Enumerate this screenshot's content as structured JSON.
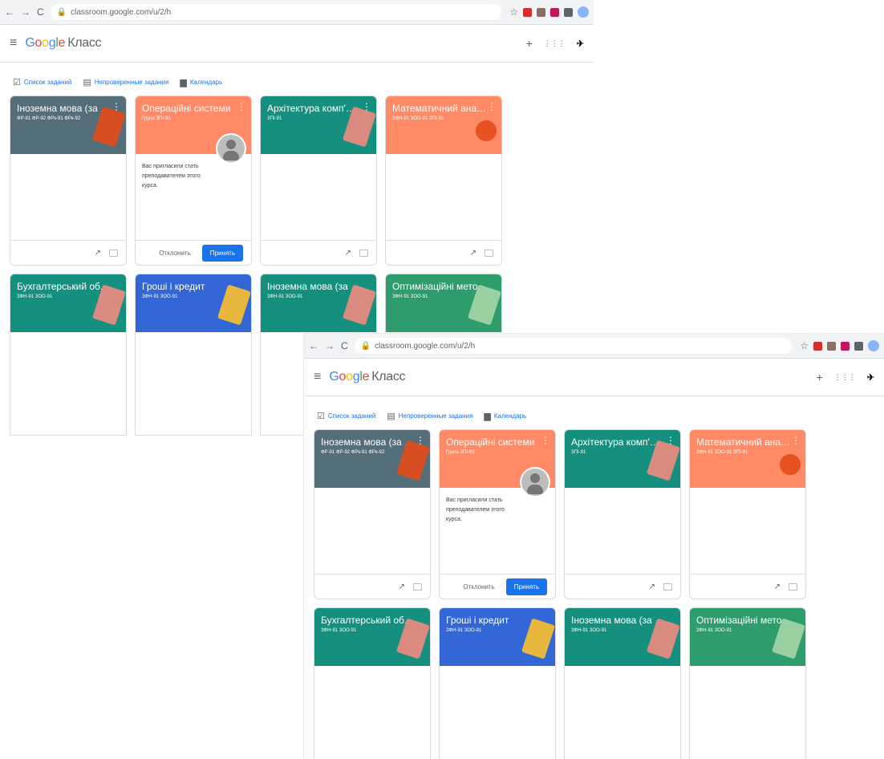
{
  "browser": {
    "url": "classroom.google.com/u/2/h"
  },
  "app": {
    "logo_g": "G",
    "logo_o1": "o",
    "logo_o2": "o",
    "logo_g2": "g",
    "logo_l": "l",
    "logo_e": "e",
    "logo_product": "Класс",
    "add_label": "+",
    "apps_label": "⋮⋮⋮"
  },
  "tools": {
    "todo": "Список заданий",
    "review": "Непроверенные задания",
    "calendar": "Календарь"
  },
  "invite": {
    "text": "Вас пригласили стать преподавателем этого курса.",
    "decline": "Отклонить",
    "accept": "Принять"
  },
  "courses": [
    {
      "title": "Іноземна мова (за п...",
      "subtitle": "ФР-91 ФР-92 ФРк-91 ФРк-92",
      "color": "#546e7a",
      "accent": "#e64a19"
    },
    {
      "title": "Операційні системи",
      "subtitle": "Група ЗПІ-91",
      "color": "#ff8a65",
      "accent": "#ff7043"
    },
    {
      "title": "Архітектура комп'ют...",
      "subtitle": "ЗПІ-91",
      "color": "#16907e",
      "accent": "#ef8a80"
    },
    {
      "title": "Математичний аналіз",
      "subtitle": "ЗФН-91 ЗОО-91 ЗПІ-91",
      "color": "#ff8a65",
      "accent": "#e64a19"
    },
    {
      "title": "Бухгалтерський обл...",
      "subtitle": "ЗФН-91 ЗОО-91",
      "color": "#16907e",
      "accent": "#ef8a80"
    },
    {
      "title": "Гроші і кредит",
      "subtitle": "ЗФН-91 ЗОО-91",
      "color": "#3367d6",
      "accent": "#fbc02d"
    },
    {
      "title": "Іноземна мова (за п...",
      "subtitle": "ЗФН-91 ЗОО-91",
      "color": "#16907e",
      "accent": "#ef8a80"
    },
    {
      "title": "Оптимізаційні мето...",
      "subtitle": "ЗФН-91 ЗОО-91",
      "color": "#2e9d6b",
      "accent": "#a5d6a7"
    }
  ],
  "icons": {
    "trend": "trend-icon",
    "folder": "folder-icon"
  }
}
